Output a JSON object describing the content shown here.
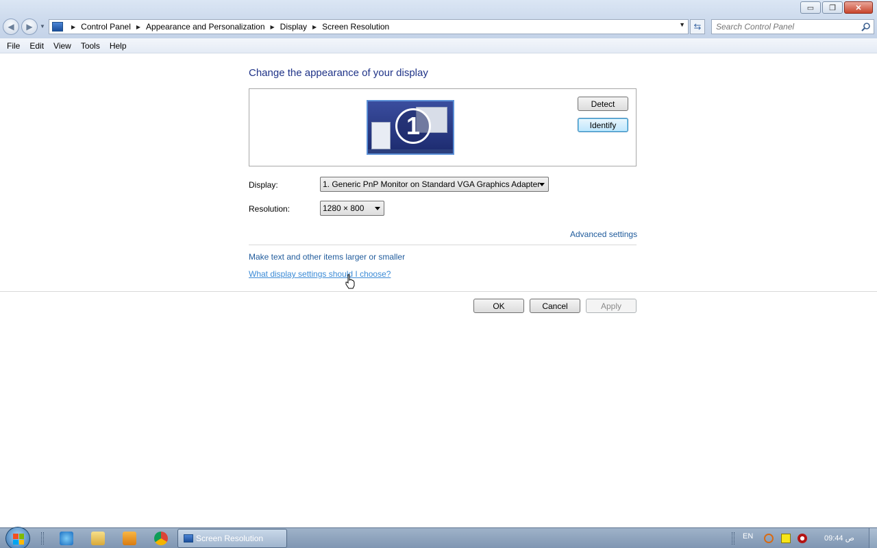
{
  "window": {
    "controls": {
      "minimize": "▭",
      "restore": "❐",
      "close": "✕"
    }
  },
  "address": {
    "crumbs": [
      "Control Panel",
      "Appearance and Personalization",
      "Display",
      "Screen Resolution"
    ],
    "search_placeholder": "Search Control Panel"
  },
  "menu": [
    "File",
    "Edit",
    "View",
    "Tools",
    "Help"
  ],
  "main": {
    "heading": "Change the appearance of your display",
    "monitor_number": "1",
    "detect_label": "Detect",
    "identify_label": "Identify",
    "display_label": "Display:",
    "display_value": "1. Generic PnP Monitor on Standard VGA Graphics Adapter",
    "resolution_label": "Resolution:",
    "resolution_value": "1280 × 800",
    "advanced_link": "Advanced settings",
    "text_size_link": "Make text and other items larger or smaller",
    "help_link": "What display settings should I choose?",
    "ok_label": "OK",
    "cancel_label": "Cancel",
    "apply_label": "Apply"
  },
  "taskbar": {
    "task_label": "Screen Resolution",
    "language": "EN",
    "clock": "09:44 ص"
  },
  "colors": {
    "heading": "#1e3287",
    "link": "#1e5a9b",
    "link_hover": "#3a8ad6"
  }
}
